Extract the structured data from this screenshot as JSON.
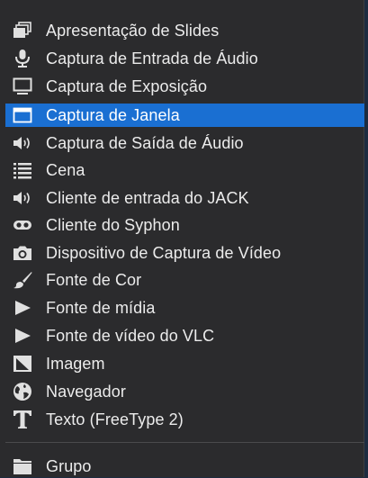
{
  "menu": {
    "items": [
      {
        "label": "Apresentação de Slides",
        "icon": "slideshow-icon"
      },
      {
        "label": "Captura de Entrada de Áudio",
        "icon": "microphone-icon"
      },
      {
        "label": "Captura de Exposição",
        "icon": "monitor-icon"
      },
      {
        "label": "Captura de Janela",
        "icon": "window-icon"
      },
      {
        "label": "Captura de Saída de Áudio",
        "icon": "speaker-icon"
      },
      {
        "label": "Cena",
        "icon": "list-icon"
      },
      {
        "label": "Cliente de entrada do JACK",
        "icon": "speaker-icon"
      },
      {
        "label": "Cliente do Syphon",
        "icon": "syphon-icon"
      },
      {
        "label": "Dispositivo de Captura de Vídeo",
        "icon": "camera-icon"
      },
      {
        "label": "Fonte de Cor",
        "icon": "brush-icon"
      },
      {
        "label": "Fonte de mídia",
        "icon": "play-icon"
      },
      {
        "label": "Fonte de vídeo do VLC",
        "icon": "play-icon"
      },
      {
        "label": "Imagem",
        "icon": "image-icon"
      },
      {
        "label": "Navegador",
        "icon": "globe-icon"
      },
      {
        "label": "Texto (FreeType 2)",
        "icon": "text-icon"
      }
    ],
    "group": {
      "label": "Grupo",
      "icon": "folder-icon"
    },
    "selected_label": "Captura de Janela",
    "colors": {
      "background": "#2b2b2d",
      "selected": "#1a6fd2",
      "text": "#ececec"
    }
  }
}
